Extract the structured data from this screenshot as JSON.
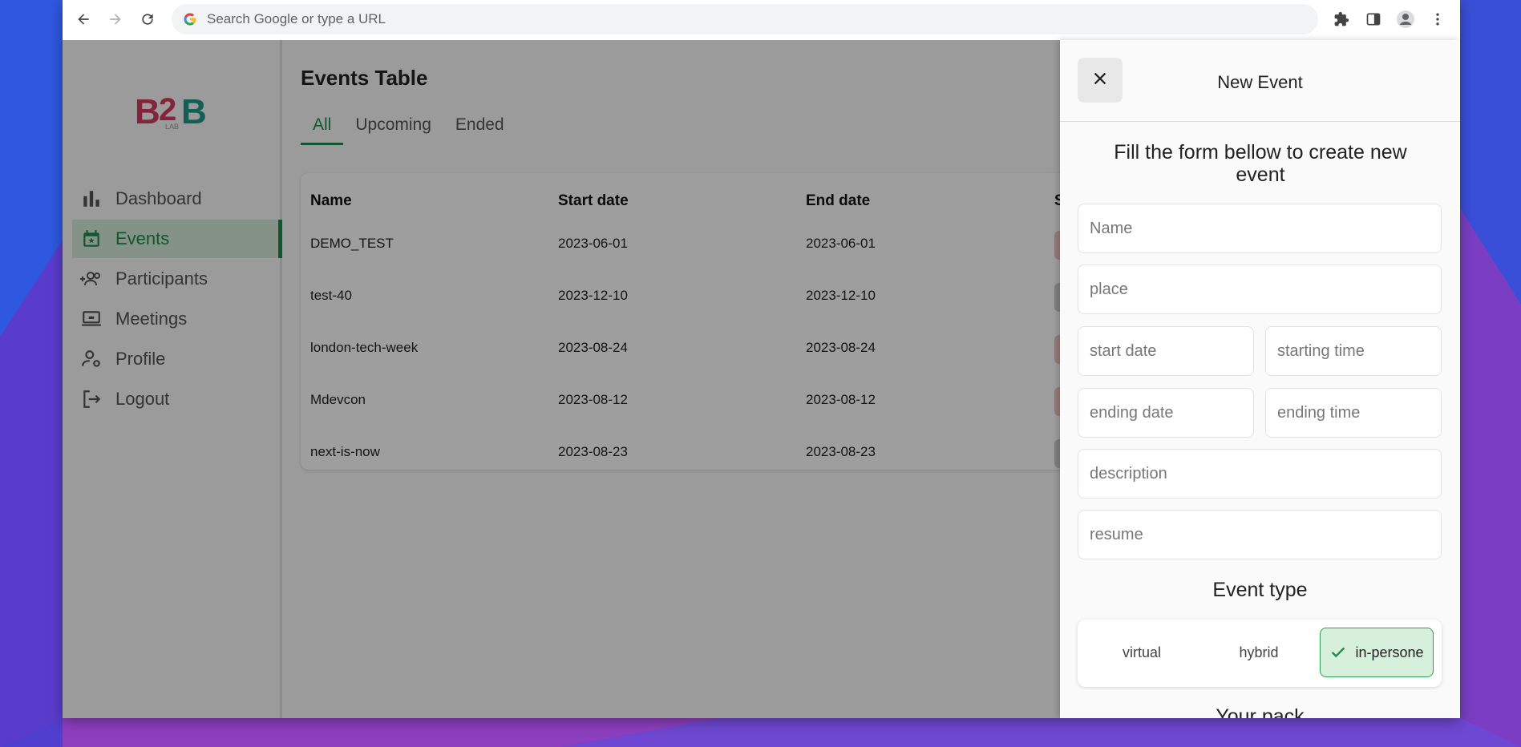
{
  "browser": {
    "omnibox_placeholder": "Search Google or type a URL"
  },
  "sidebar": {
    "logo_text": "B2B LAB",
    "items": [
      {
        "label": "Dashboard",
        "icon": "bar-chart-icon",
        "active": false
      },
      {
        "label": "Events",
        "icon": "calendar-star-icon",
        "active": true
      },
      {
        "label": "Participants",
        "icon": "group-add-icon",
        "active": false
      },
      {
        "label": "Meetings",
        "icon": "laptop-icon",
        "active": false
      },
      {
        "label": "Profile",
        "icon": "person-settings-icon",
        "active": false
      },
      {
        "label": "Logout",
        "icon": "logout-icon",
        "active": false
      }
    ]
  },
  "main": {
    "title": "Events Table",
    "tabs": [
      {
        "label": "All",
        "active": true
      },
      {
        "label": "Upcoming",
        "active": false
      },
      {
        "label": "Ended",
        "active": false
      }
    ],
    "table": {
      "columns": [
        "Name",
        "Start date",
        "End date",
        "S"
      ],
      "rows": [
        {
          "name": "DEMO_TEST",
          "start": "2023-06-01",
          "end": "2023-06-01",
          "status_color": "#f2c6c6"
        },
        {
          "name": "test-40",
          "start": "2023-12-10",
          "end": "2023-12-10",
          "status_color": "#cfcfcf"
        },
        {
          "name": "london-tech-week",
          "start": "2023-08-24",
          "end": "2023-08-24",
          "status_color": "#f2c6c6"
        },
        {
          "name": "Mdevcon",
          "start": "2023-08-12",
          "end": "2023-08-12",
          "status_color": "#f2c6c6"
        },
        {
          "name": "next-is-now",
          "start": "2023-08-23",
          "end": "2023-08-23",
          "status_color": "#cfcfcf"
        }
      ]
    }
  },
  "drawer": {
    "title": "New Event",
    "subtitle": "Fill the form bellow  to create new event",
    "fields": {
      "name": "Name",
      "place": "place",
      "start_date": "start date",
      "starting_time": "starting time",
      "ending_date": "ending date",
      "ending_time": "ending time",
      "description": "description",
      "resume": "resume"
    },
    "event_type_label": "Event type",
    "event_types": [
      "virtual",
      "hybrid",
      "in-persone"
    ],
    "selected_event_type": "in-persone",
    "next_section_label": "Your pack"
  },
  "colors": {
    "accent": "#1f8a4a",
    "active_bg": "#d6ecdc",
    "logo_pink": "#d63a5e",
    "logo_teal": "#1d9a8a"
  }
}
